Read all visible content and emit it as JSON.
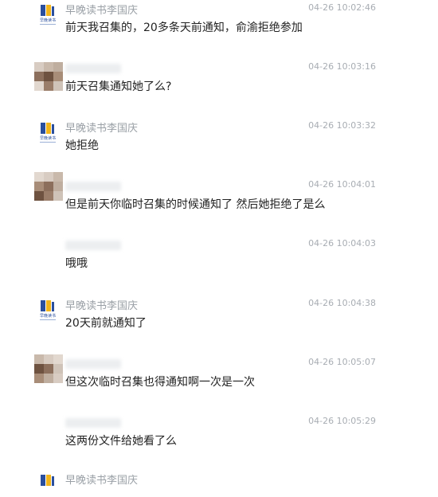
{
  "messages": [
    {
      "avatar": "logo",
      "sender": "早晚读书李国庆",
      "time": "04-26 10:02:46",
      "text": "前天我召集的，20多条天前通知，俞渝拒绝参加"
    },
    {
      "avatar": "user",
      "sender": "",
      "time": "04-26 10:03:16",
      "text": "前天召集通知她了么?"
    },
    {
      "avatar": "logo",
      "sender": "早晚读书李国庆",
      "time": "04-26 10:03:32",
      "text": "她拒绝"
    },
    {
      "avatar": "user",
      "sender": "",
      "time": "04-26 10:04:01",
      "text": "但是前天你临时召集的时候通知了 然后她拒绝了是么"
    },
    {
      "avatar": "blank",
      "sender": "",
      "time": "04-26 10:04:03",
      "text": "哦哦"
    },
    {
      "avatar": "logo",
      "sender": "早晚读书李国庆",
      "time": "04-26 10:04:38",
      "text": "20天前就通知了"
    },
    {
      "avatar": "user",
      "sender": "",
      "time": "04-26 10:05:07",
      "text": "但这次临时召集也得通知啊一次是一次"
    },
    {
      "avatar": "blank",
      "sender": "",
      "time": "04-26 10:05:29",
      "text": "这两份文件给她看了么"
    },
    {
      "avatar": "logo",
      "sender": "早晚读书李国庆",
      "time": "",
      "text": ""
    }
  ],
  "colors": {
    "logo_blue": "#2a4f9e",
    "logo_yellow": "#f2b51c"
  },
  "logo_caption": "早晚读书"
}
